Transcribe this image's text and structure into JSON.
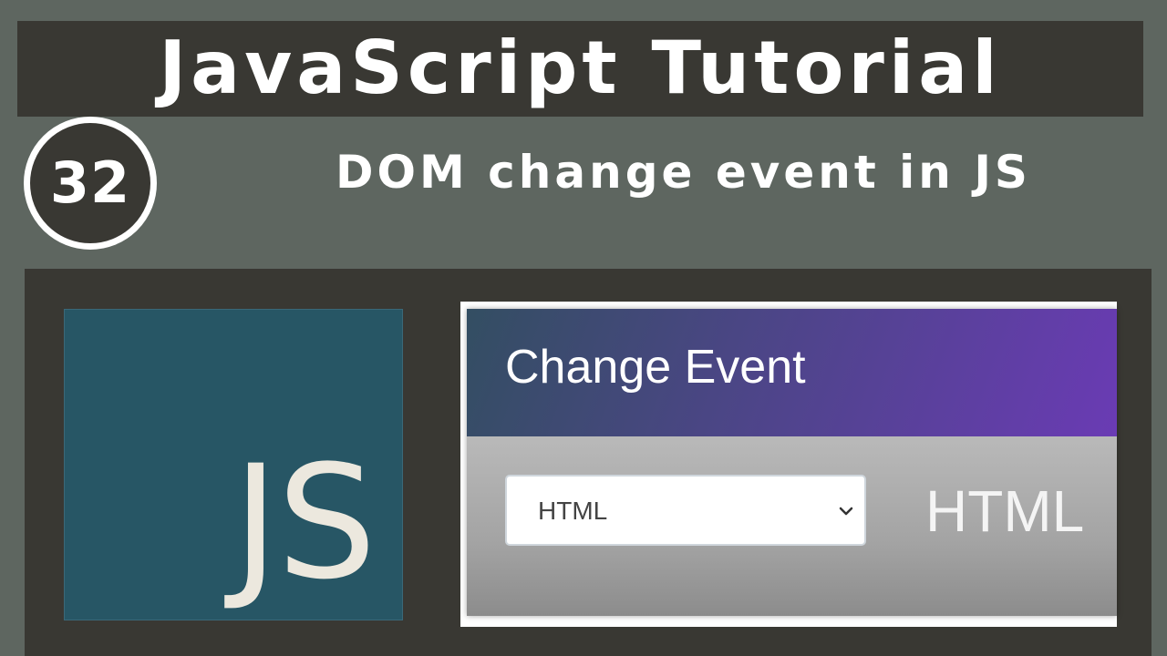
{
  "header": {
    "title": "JavaScript Tutorial"
  },
  "episode": {
    "number": "32"
  },
  "subtitle": "DOM change event in JS",
  "logo": {
    "text": "JS",
    "icon": "javascript-logo-icon",
    "background_color": "#275665",
    "text_color": "#ece8de"
  },
  "demo": {
    "card_title": "Change Event",
    "select": {
      "selected_value": "HTML",
      "icon": "chevron-down-icon"
    },
    "output": "HTML",
    "header_gradient": [
      "#334e62",
      "#6a3bb4"
    ]
  },
  "colors": {
    "background": "#5e6660",
    "panel": "#393833",
    "text": "#ffffff"
  }
}
